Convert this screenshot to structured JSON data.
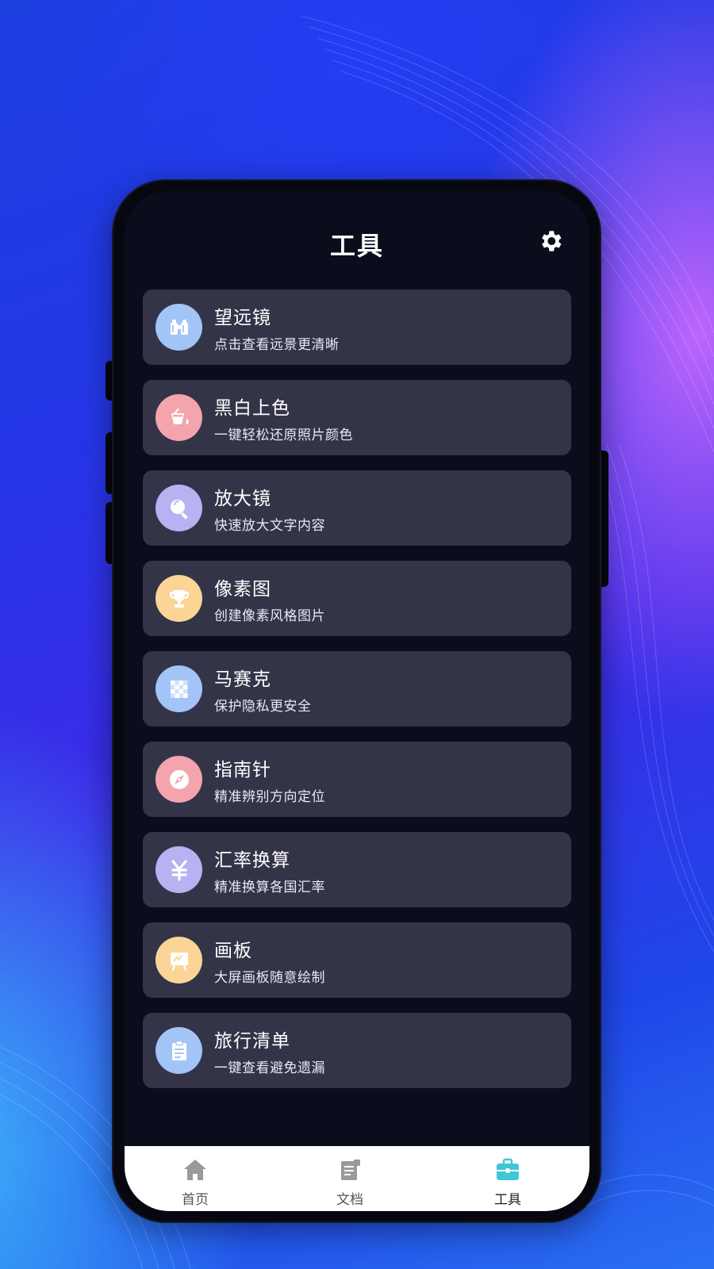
{
  "header": {
    "title": "工具",
    "settings_icon": "gear-icon"
  },
  "tools": [
    {
      "title": "望远镜",
      "subtitle": "点击查看远景更清晰",
      "icon": "binoculars-icon",
      "color": "#a3c4f7"
    },
    {
      "title": "黑白上色",
      "subtitle": "一键轻松还原照片颜色",
      "icon": "paint-bucket-icon",
      "color": "#f4a4ad"
    },
    {
      "title": "放大镜",
      "subtitle": "快速放大文字内容",
      "icon": "magnifier-icon",
      "color": "#b8b2f2"
    },
    {
      "title": "像素图",
      "subtitle": "创建像素风格图片",
      "icon": "trophy-icon",
      "color": "#fbd596"
    },
    {
      "title": "马赛克",
      "subtitle": "保护隐私更安全",
      "icon": "mosaic-icon",
      "color": "#a3c4f7"
    },
    {
      "title": "指南针",
      "subtitle": "精准辨别方向定位",
      "icon": "compass-icon",
      "color": "#f4a4ad"
    },
    {
      "title": "汇率换算",
      "subtitle": "精准换算各国汇率",
      "icon": "yen-icon",
      "color": "#b8b2f2"
    },
    {
      "title": "画板",
      "subtitle": "大屏画板随意绘制",
      "icon": "drawing-board-icon",
      "color": "#fbd596"
    },
    {
      "title": "旅行清单",
      "subtitle": "一键查看避免遗漏",
      "icon": "clipboard-icon",
      "color": "#a3c4f7"
    }
  ],
  "tabbar": {
    "items": [
      {
        "label": "首页",
        "icon": "home-icon",
        "active": false
      },
      {
        "label": "文档",
        "icon": "document-icon",
        "active": false
      },
      {
        "label": "工具",
        "icon": "toolbox-icon",
        "active": true
      }
    ],
    "active_color": "#3fc7d6",
    "inactive_color": "#9a9a9a"
  }
}
